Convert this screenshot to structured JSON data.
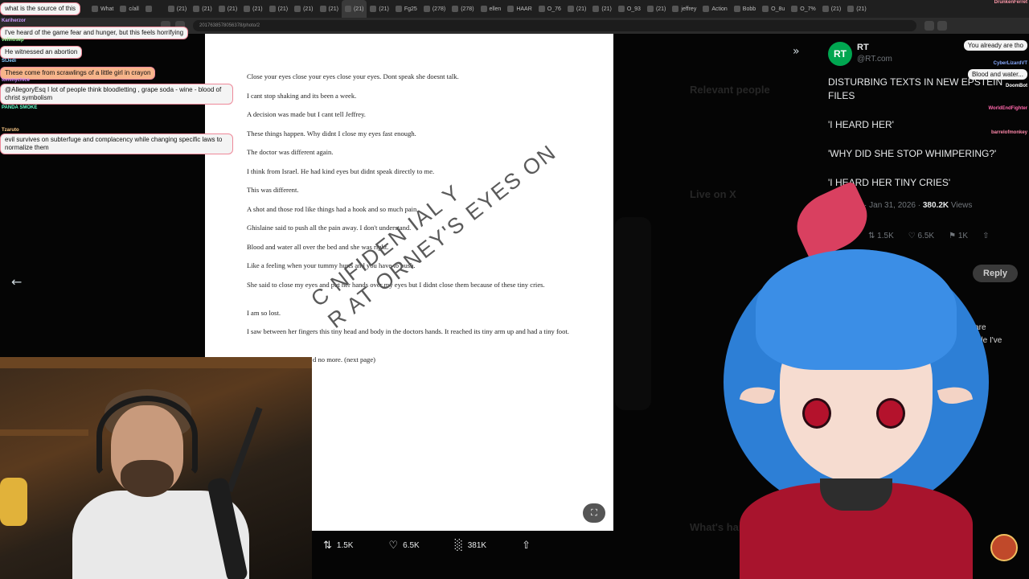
{
  "browser": {
    "tabs": [
      {
        "label": "What"
      },
      {
        "label": "c/all"
      },
      {
        "label": ""
      },
      {
        "label": "(21)"
      },
      {
        "label": "(21)"
      },
      {
        "label": "(21)"
      },
      {
        "label": "(21)"
      },
      {
        "label": "(21)"
      },
      {
        "label": "(21)"
      },
      {
        "label": "(21)"
      },
      {
        "label": "(21)"
      },
      {
        "label": "(21)"
      },
      {
        "label": "Fg25"
      },
      {
        "label": "(278)"
      },
      {
        "label": "(278)"
      },
      {
        "label": "ellen"
      },
      {
        "label": "HAAR"
      },
      {
        "label": "O_76"
      },
      {
        "label": "(21)"
      },
      {
        "label": "(21)"
      },
      {
        "label": "O_93"
      },
      {
        "label": "(21)"
      },
      {
        "label": "jeffrey"
      },
      {
        "label": "Action"
      },
      {
        "label": "Bobb"
      },
      {
        "label": "O_8u"
      },
      {
        "label": "O_7%"
      },
      {
        "label": "(21)"
      },
      {
        "label": "(21)"
      }
    ],
    "url": "2017638578056378/photo/2",
    "zoom": "100%"
  },
  "chat_left": [
    {
      "user": "",
      "message": "what is the source of this",
      "highlight": false,
      "user_color": "#9ad"
    },
    {
      "user": "Kariherzor",
      "message": "I've heard of the game fear and hunger, but this feels horrifying",
      "highlight": false,
      "user_color": "#c9f"
    },
    {
      "user": "vellnosep",
      "message": "He witnessed an abortion",
      "highlight": false,
      "user_color": "#9f9"
    },
    {
      "user": "StJedi",
      "message": "These come from scrawlings of a little girl in crayon",
      "highlight": true,
      "user_color": "#8cf"
    },
    {
      "user": "tommychice",
      "message": "@AllegoryEsq I lot of people think bloodletting , grape soda - wine - blood of christ symbolism",
      "highlight": false,
      "user_color": "#c8f"
    },
    {
      "user": "PANDA SMOKE",
      "message": "",
      "highlight": false,
      "user_color": "#6fc"
    },
    {
      "user": "Tzaruto",
      "message": "evil survives on subterfuge and complacency while changing specific laws to normalize them",
      "highlight": false,
      "user_color": "#fc8"
    }
  ],
  "chat_right": [
    {
      "user": "DrunkenFerret",
      "message": "",
      "user_color": "#f9a"
    },
    {
      "user": "",
      "message": "You already are tho",
      "user_color": "#fff"
    },
    {
      "user": "CyberLizardVT",
      "message": "Blood and water...",
      "user_color": "#8af"
    },
    {
      "user": "DoomBot",
      "message": "",
      "user_color": "#fff"
    },
    {
      "user": "WorldEndFighter",
      "message": "",
      "user_color": "#f6a"
    },
    {
      "user": "barrelofmonkey",
      "message": "",
      "user_color": "#f8a"
    }
  ],
  "document": {
    "lines": [
      "Close your eyes close your eyes close your eyes. Dont speak she doesnt talk.",
      "I cant stop shaking and its been a week.",
      "A decision was made but I cant tell Jeffrey.",
      "These things happen. Why didnt I close my eyes fast enough.",
      "The doctor was different again.",
      "I think from Israel.     He had kind eyes but didnt speak directly to me.",
      "This was different.",
      "A shot and those rod like things had a hook and so much pain.",
      "Ghislaine said to push all the pain away. I don't understand.",
      "Blood and water all over the bed and she was right.",
      "Like a feeling when your tummy hurts and you have to push.",
      "She said to close my eyes and put her hands over my eyes but I didnt close them because of these tiny cries.",
      "I am so lost.",
      "I saw between her fingers this tiny head and body in the doctors hands. It reached its tiny arm up and had a tiny foot.",
      "d no more.   (next page)"
    ],
    "watermark_line1": "C  NFIDEN  IAL            Y",
    "watermark_line2": "R AT ORNEY'S EYES ON"
  },
  "engagement": {
    "reposts": "1.5K",
    "likes": "6.5K",
    "views": "381K"
  },
  "tweet": {
    "name": "RT",
    "handle": "@RT.com",
    "paragraphs": [
      "DISTURBING TEXTS IN NEW EPSTEIN FILES",
      "'I HEARD HER'",
      "'WHY DID SHE STOP WHIMPERING?'",
      "'I HEARD HER TINY CRIES'"
    ],
    "time": "10:37 AM · Jan 31, 2026 · ",
    "views_count": "380.2K",
    "views_label": " Views",
    "reposts": "1.5K",
    "likes": "6.5K",
    "bookmarks": "1K",
    "reply_label": "Reply"
  },
  "background_ghost_text": {
    "relevant_people": "Relevant people",
    "live_on_x": "Live on X",
    "whats_happening": "What's happening",
    "reply_fragment_1": "tos are",
    "reply_fragment_2": "orst file I've"
  }
}
